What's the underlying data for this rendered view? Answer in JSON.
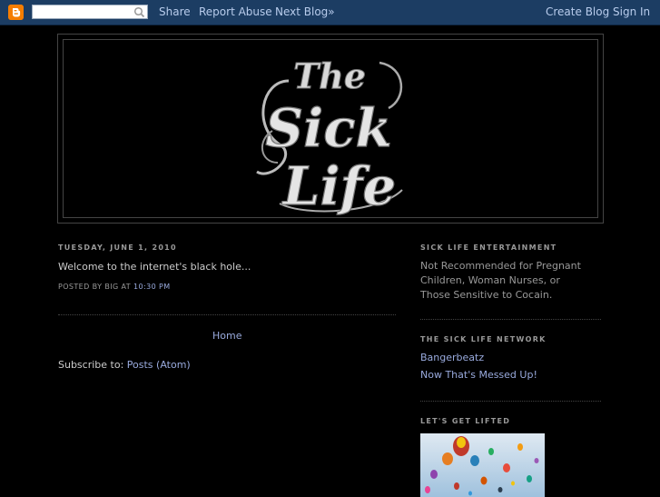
{
  "navbar": {
    "logo_icon": "blogger-b-icon",
    "search_placeholder": "",
    "links": [
      "Share",
      "Report Abuse",
      "Next Blog»"
    ],
    "right_links": [
      "Create Blog",
      "Sign In"
    ]
  },
  "header": {
    "logo_text": [
      "The",
      "Sick",
      "Life"
    ]
  },
  "post": {
    "date": "TUESDAY, JUNE 1, 2010",
    "body": "Welcome to the internet's black hole...",
    "posted_by_prefix": "POSTED BY BIG AT",
    "time": "10:30 PM"
  },
  "main": {
    "home_label": "Home",
    "subscribe_prefix": "Subscribe to:",
    "subscribe_link": "Posts (Atom)"
  },
  "sidebar": {
    "section1": {
      "heading": "SICK LIFE ENTERTAINMENT",
      "text": "Not Recommended for Pregnant Children, Woman Nurses, or Those Sensitive to Cocain."
    },
    "section2": {
      "heading": "THE SICK LIFE NETWORK",
      "links": [
        "Bangerbeatz",
        "Now That's Messed Up!"
      ]
    },
    "section3": {
      "heading": "LET'S GET LIFTED",
      "image_icon": "hot-air-balloons-photo"
    }
  },
  "colors": {
    "navbar_bg": "#1c3d63",
    "link": "#99aadd",
    "background": "#000000"
  }
}
